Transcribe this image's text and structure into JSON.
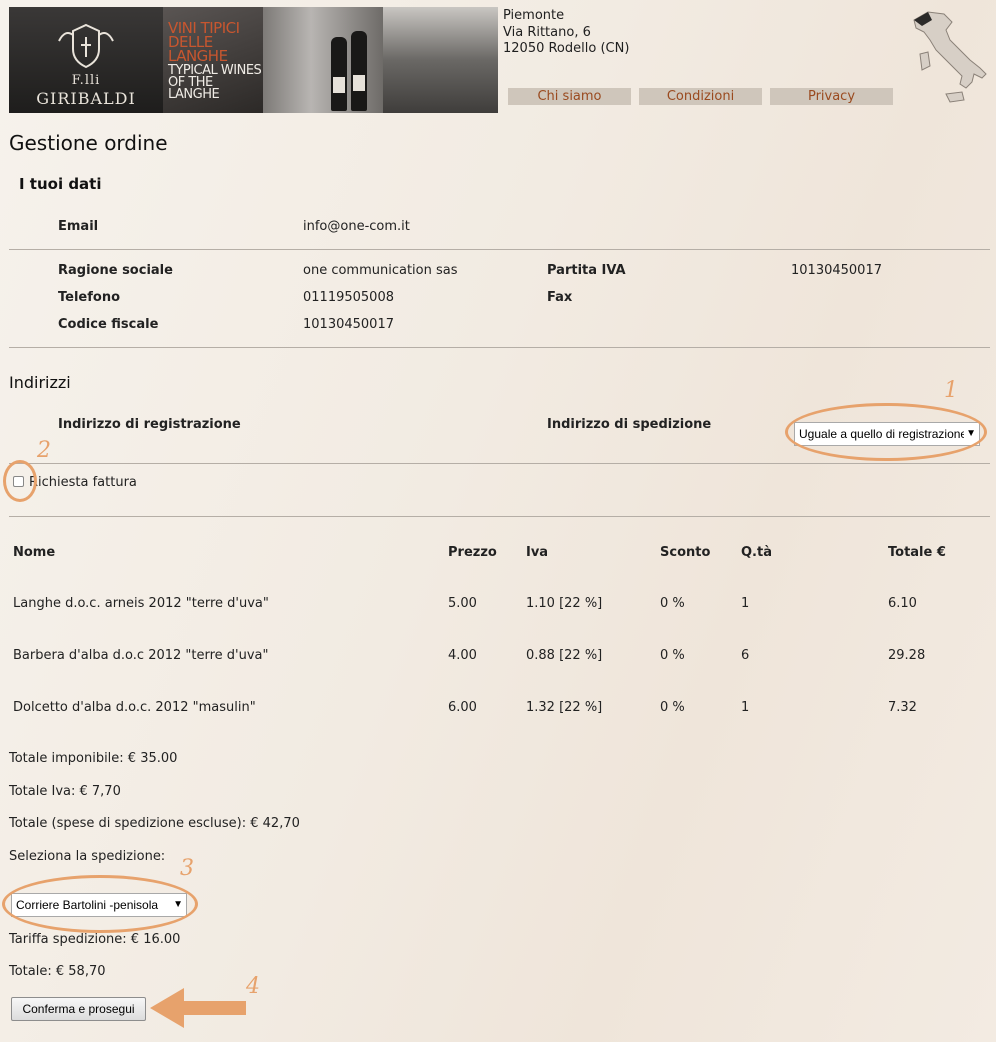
{
  "header": {
    "logo_line1": "F.lli",
    "logo_line2": "GIRIBALDI",
    "banner_title": "VINI TIPICI DELLE LANGHE",
    "banner_subtitle": "TYPICAL WINES OF THE LANGHE",
    "address": {
      "region": "Piemonte",
      "street": "Via Rittano, 6",
      "city": "12050 Rodello (CN)"
    },
    "nav": [
      {
        "label": "Chi siamo"
      },
      {
        "label": "Condizioni"
      },
      {
        "label": "Privacy"
      }
    ]
  },
  "page_title": "Gestione ordine",
  "your_data": {
    "title": "I tuoi dati",
    "email_label": "Email",
    "email_value": "info@one-com.it",
    "company_label": "Ragione sociale",
    "company_value": "one communication sas",
    "vat_label": "Partita IVA",
    "vat_value": "10130450017",
    "phone_label": "Telefono",
    "phone_value": "01119505008",
    "fax_label": "Fax",
    "fax_value": "",
    "tax_code_label": "Codice fiscale",
    "tax_code_value": "10130450017"
  },
  "addresses": {
    "title": "Indirizzi",
    "registration_label": "Indirizzo di registrazione",
    "shipping_label": "Indirizzo di spedizione",
    "shipping_selected": "Uguale a quello di registrazione"
  },
  "invoice": {
    "label": "Richiesta fattura",
    "checked": false
  },
  "annotations": [
    "1",
    "2",
    "3",
    "4"
  ],
  "accent_color": "#e7a26c",
  "table": {
    "headers": [
      "Nome",
      "Prezzo",
      "Iva",
      "Sconto",
      "Q.tà",
      "Totale €"
    ],
    "rows": [
      {
        "name": "Langhe d.o.c. arneis 2012 \"terre d'uva\"",
        "price": "5.00",
        "iva": "1.10 [22 %]",
        "discount": "0 %",
        "qty": "1",
        "total": "6.10"
      },
      {
        "name": "Barbera d'alba d.o.c 2012 \"terre d'uva\"",
        "price": "4.00",
        "iva": "0.88 [22 %]",
        "discount": "0 %",
        "qty": "6",
        "total": "29.28"
      },
      {
        "name": "Dolcetto d'alba d.o.c. 2012 \"masulin\"",
        "price": "6.00",
        "iva": "1.32 [22 %]",
        "discount": "0 %",
        "qty": "1",
        "total": "7.32"
      }
    ]
  },
  "totals": {
    "taxable": "Totale imponibile: € 35.00",
    "iva": "Totale Iva:  €  7,70",
    "excl_shipping": "Totale (spese di spedizione escluse): €  42,70",
    "select_shipping": "Seleziona la spedizione:",
    "shipping_selected": "Corriere Bartolini -penisola",
    "shipping_rate": "Tariffa spedizione: € 16.00",
    "grand_total": "Totale: €   58,70"
  },
  "confirm_label": "Conferma e prosegui"
}
